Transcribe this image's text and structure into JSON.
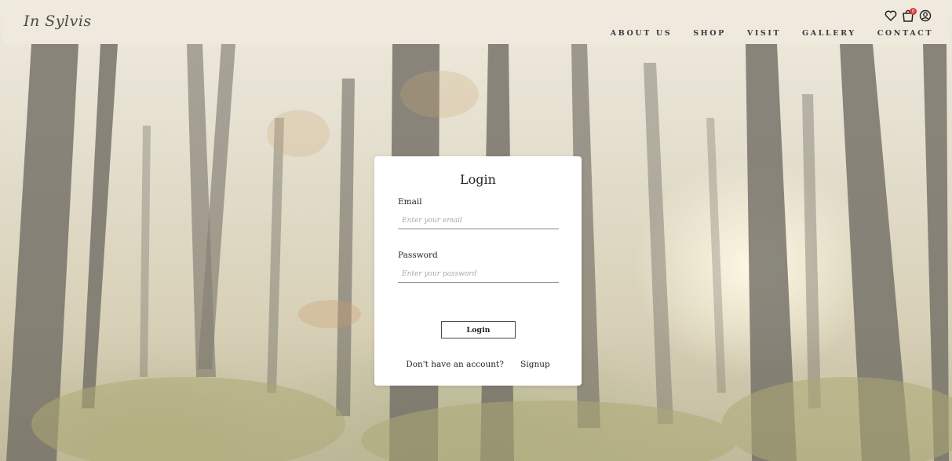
{
  "header": {
    "logo": "In Sylvis",
    "nav": {
      "about": "ABOUT US",
      "shop": "SHOP",
      "visit": "VISIT",
      "gallery": "GALLERY",
      "contact": "CONTACT"
    },
    "icons": [
      "heart-icon",
      "shopping-bag-icon",
      "user-circle-icon"
    ],
    "cart_badge": "0"
  },
  "login": {
    "title": "Login",
    "email_label": "Email",
    "email_placeholder": "Enter your email",
    "password_label": "Password",
    "password_placeholder": "Enter your password",
    "submit_label": "Login",
    "no_account_text": "Don't have an account?",
    "signup_link": "Signup"
  },
  "colors": {
    "header_bg": "#f0e8de",
    "badge": "#d43a3a",
    "card_bg": "#ffffff",
    "button_border": "#4a4a3a"
  }
}
